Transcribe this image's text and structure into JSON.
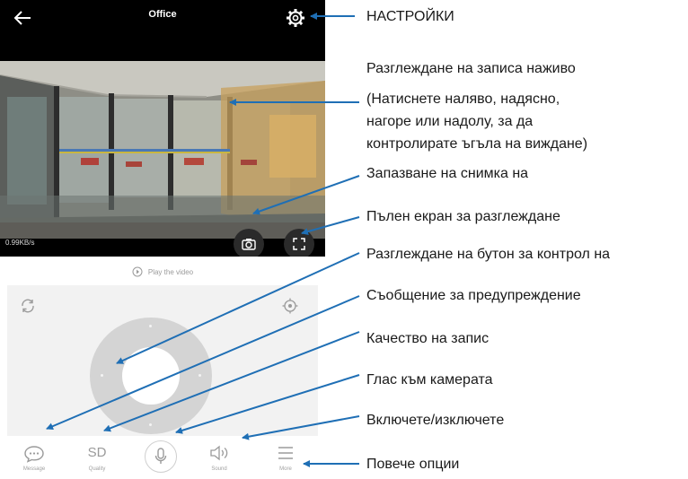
{
  "screen": {
    "title": "Office",
    "speed": "0.99KB/s",
    "play_label": "Play the video"
  },
  "bottom_bar": {
    "message": "Message",
    "quality_value": "SD",
    "quality": "Quality",
    "sound": "Sound",
    "more": "More"
  },
  "annotations": {
    "settings": "НАСТРОЙКИ",
    "live_view": "Разглеждане на записа наживо",
    "live_hint_1": "(Натиснете наляво, надясно,",
    "live_hint_2": "нагоре или надолу, за да",
    "live_hint_3": "контролирате ъгъла на виждане)",
    "snapshot": "Запазване на снимка на",
    "fullscreen": "Пълен екран за разглеждане",
    "control": "Разглеждане на бутон за контрол на",
    "alert": "Съобщение за предупреждение",
    "quality": "Качество на запис",
    "voice": "Глас към камерата",
    "sound": "Включете/изключете",
    "more": "Повече опции"
  },
  "colors": {
    "arrow": "#1f6fb5",
    "video_bg": "#000000",
    "panel_bg": "#f2f2f2"
  },
  "icons": [
    "back-arrow-icon",
    "gear-icon",
    "camera-icon",
    "fullscreen-icon",
    "rotate-icon",
    "target-icon",
    "chat-icon",
    "mic-icon",
    "sound-icon",
    "menu-icon"
  ]
}
